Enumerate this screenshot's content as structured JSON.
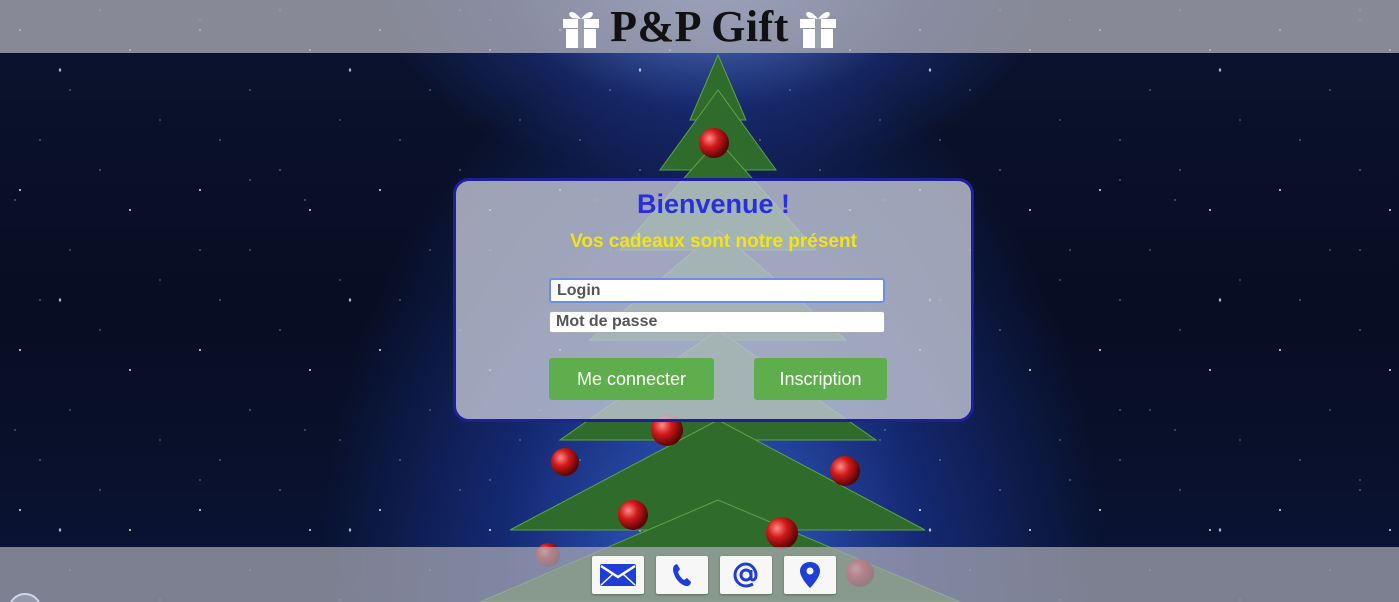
{
  "header": {
    "brand_title": "P&P Gift",
    "icon_left": "gift-icon",
    "icon_right": "gift-icon"
  },
  "login_card": {
    "title": "Bienvenue !",
    "subtitle": "Vos cadeaux sont notre présent",
    "login_placeholder": "Login",
    "password_placeholder": "Mot de passe",
    "connect_button": "Me connecter",
    "signup_button": "Inscription"
  },
  "footer": {
    "contacts": [
      {
        "icon": "mail-icon"
      },
      {
        "icon": "phone-icon"
      },
      {
        "icon": "at-sign-icon"
      },
      {
        "icon": "location-pin-icon"
      }
    ]
  },
  "colors": {
    "accent_blue": "#2b2fd8",
    "subtitle_yellow": "#f2e31a",
    "button_green": "#5fae4d",
    "card_border": "#1d1f9b",
    "icon_blue": "#1f3ed8"
  }
}
